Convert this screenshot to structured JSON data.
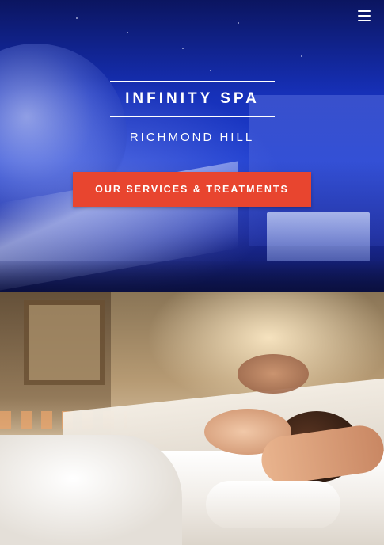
{
  "header": {
    "menu_icon": "hamburger-menu-icon"
  },
  "hero": {
    "brand": "INFINITY SPA",
    "location": "RICHMOND HILL",
    "cta_label": "OUR SERVICES & TREATMENTS",
    "overlay_color": "#1f3fd0",
    "cta_color": "#e8452f"
  }
}
